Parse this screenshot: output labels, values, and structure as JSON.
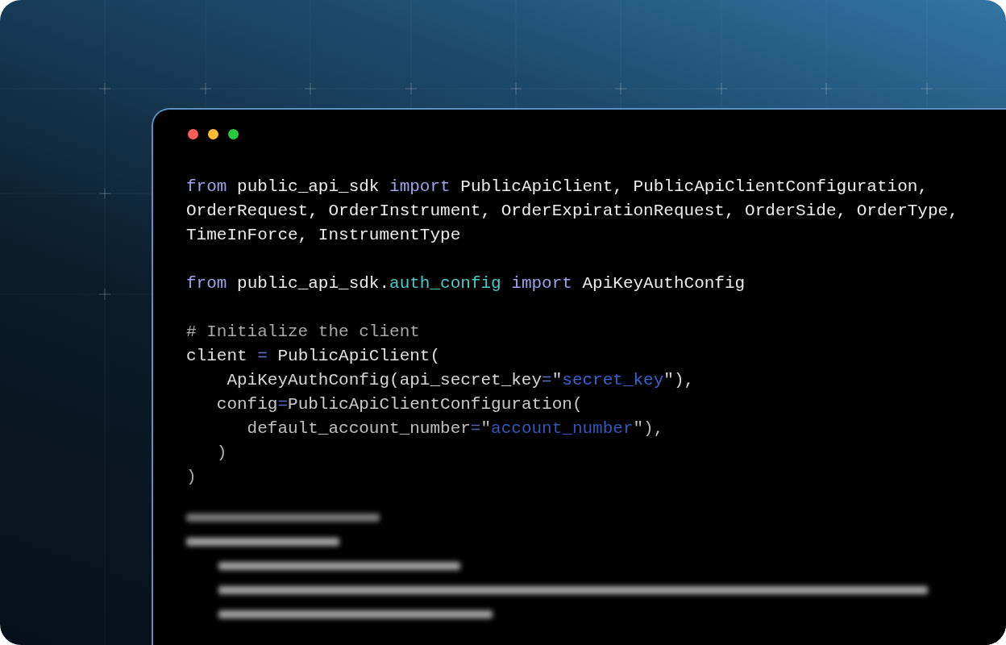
{
  "window": {
    "controls": [
      {
        "color": "#ff5f57"
      },
      {
        "color": "#febc2e"
      },
      {
        "color": "#28c840"
      }
    ]
  },
  "code_blocks": [
    {
      "lines": [
        [
          {
            "kind": "keyword",
            "text": "from"
          },
          {
            "kind": "plain",
            "text": " public_api_sdk "
          },
          {
            "kind": "keyword",
            "text": "import"
          },
          {
            "kind": "plain",
            "text": " PublicApiClient, PublicApiClientConfiguration,"
          }
        ],
        [
          {
            "kind": "plain",
            "text": "OrderRequest, OrderInstrument, OrderExpirationRequest, OrderSide, OrderType,"
          }
        ],
        [
          {
            "kind": "plain",
            "text": "TimeInForce, InstrumentType"
          }
        ]
      ]
    },
    {
      "lines": [
        [
          {
            "kind": "keyword",
            "text": "from"
          },
          {
            "kind": "plain",
            "text": " public_api_sdk."
          },
          {
            "kind": "module",
            "text": "auth_config"
          },
          {
            "kind": "keyword",
            "text": " import"
          },
          {
            "kind": "plain",
            "text": " ApiKeyAuthConfig"
          }
        ]
      ]
    },
    {
      "lines": [
        [
          {
            "kind": "comment",
            "text": "# Initialize the client"
          }
        ],
        [
          {
            "kind": "plain",
            "text": "client "
          },
          {
            "kind": "operator",
            "text": "="
          },
          {
            "kind": "plain",
            "text": " PublicApiClient("
          }
        ],
        [
          {
            "kind": "plain",
            "text": "    ApiKeyAuthConfig(api_secret_key"
          },
          {
            "kind": "operator",
            "text": "="
          },
          {
            "kind": "plain",
            "text": "\""
          },
          {
            "kind": "string",
            "text": "secret_key"
          },
          {
            "kind": "plain",
            "text": "\"),"
          }
        ],
        [
          {
            "kind": "plain",
            "text": "   config"
          },
          {
            "kind": "operator",
            "text": "="
          },
          {
            "kind": "plain",
            "text": "PublicApiClientConfiguration("
          }
        ],
        [
          {
            "kind": "plain",
            "text": "      default_account_number"
          },
          {
            "kind": "operator",
            "text": "="
          },
          {
            "kind": "plain",
            "text": "\""
          },
          {
            "kind": "string",
            "text": "account_number"
          },
          {
            "kind": "plain",
            "text": "\"),"
          }
        ],
        [
          {
            "kind": "plain",
            "text": "   )"
          }
        ],
        [
          {
            "kind": "plain",
            "text": ")"
          }
        ]
      ]
    }
  ]
}
